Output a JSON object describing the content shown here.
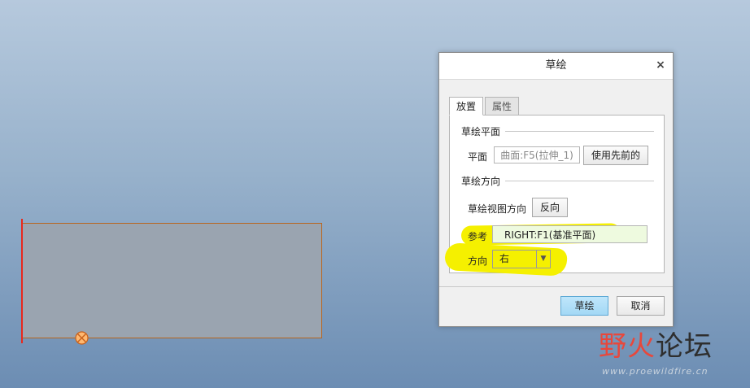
{
  "dialog": {
    "title": "草绘",
    "close_glyph": "×",
    "tabs": [
      {
        "label": "放置",
        "active": true
      },
      {
        "label": "属性",
        "active": false
      }
    ],
    "sketch_plane": {
      "group_label": "草绘平面",
      "plane_label": "平面",
      "plane_value": "曲面:F5(拉伸_1)",
      "use_previous_label": "使用先前的"
    },
    "sketch_orientation": {
      "group_label": "草绘方向",
      "view_dir_label": "草绘视图方向",
      "flip_label": "反向",
      "reference_label": "参考",
      "reference_value": "RIGHT:F1(基准平面)",
      "orientation_label": "方向",
      "orientation_value": "右"
    },
    "buttons": {
      "sketch": "草绘",
      "cancel": "取消"
    }
  },
  "watermark": {
    "text_a": "野火",
    "text_b": "论坛",
    "url": "www.proewildfire.cn"
  },
  "colors": {
    "highlight": "#f5f000",
    "model_edge": "#b8651e",
    "selected_edge": "#e8281c",
    "primary_button": "#a3d8f5"
  }
}
